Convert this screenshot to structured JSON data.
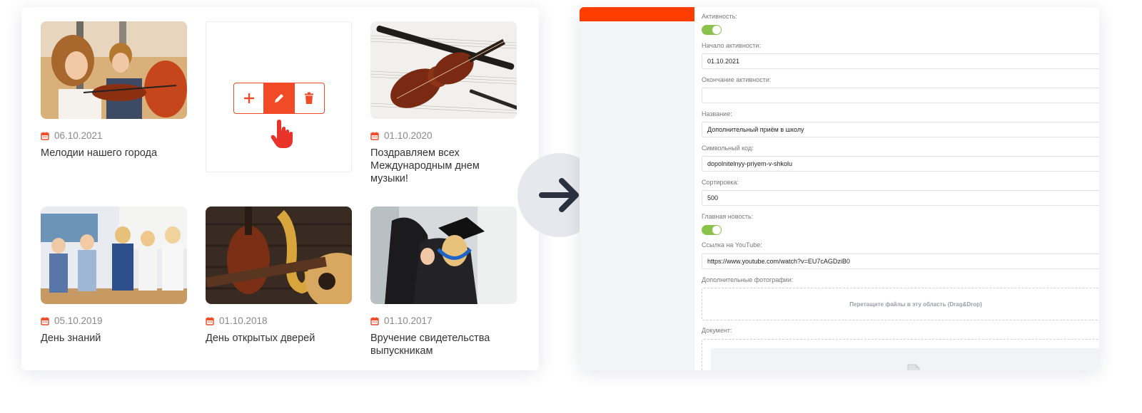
{
  "news": {
    "items": [
      {
        "date": "06.10.2021",
        "title": "Мелодии нашего города",
        "image": "children-violin-cello-photo"
      },
      {
        "date": "01.10.2020",
        "title": "Поздравляем всех Международным днем музыки!",
        "image": "violin-oboe-sheet-music-photo"
      },
      {
        "date": "05.10.2019",
        "title": "День знаний",
        "image": "schoolchildren-classroom-photo"
      },
      {
        "date": "01.10.2018",
        "title": "День открытых дверей",
        "image": "violin-saxophone-guitar-photo"
      },
      {
        "date": "01.10.2017",
        "title": "Вручение свидетельства выпускникам",
        "image": "graduates-hugging-photo"
      }
    ],
    "actions": [
      "plus-icon",
      "pencil-icon",
      "trash-icon"
    ],
    "accent_color": "#f04a26"
  },
  "admin": {
    "activity": {
      "label": "Активность:",
      "enabled": true
    },
    "start_date": {
      "label": "Начало активности:",
      "value": "01.10.2021"
    },
    "end_date": {
      "label": "Окончание активности:",
      "value": ""
    },
    "name": {
      "label": "Название:",
      "value": "Дополнительный приём в школу"
    },
    "code": {
      "label": "Символьный код:",
      "value": "dopolnitelnyy-priyem-v-shkolu"
    },
    "sort": {
      "label": "Сортировка:",
      "value": "500"
    },
    "main_news": {
      "label": "Главная новость:",
      "enabled": true
    },
    "youtube": {
      "label": "Ссылка на YouTube:",
      "value": "https://www.youtube.com/watch?v=EU7cAGDziB0"
    },
    "photos": {
      "label": "Дополнительные фотографии:",
      "dropzone_text": "Перетащите файлы в эту область (Drag&Drop)"
    },
    "document": {
      "label": "Документ:"
    },
    "toggle_color": "#8bc34a",
    "sidebar_accent": "#ff3d00"
  }
}
